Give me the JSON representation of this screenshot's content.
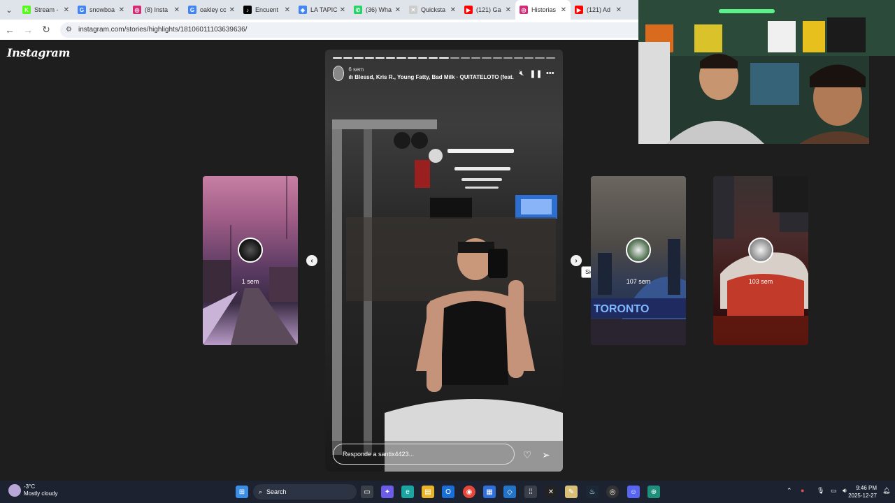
{
  "browser": {
    "tabs": [
      {
        "label": "Stream -",
        "favicon_color": "#53fc18",
        "glyph": "K"
      },
      {
        "label": "snowboa",
        "favicon_color": "#4285f4",
        "glyph": "G"
      },
      {
        "label": "(8) Insta",
        "favicon_color": "#d62976",
        "glyph": "◎"
      },
      {
        "label": "oakley cc",
        "favicon_color": "#4285f4",
        "glyph": "G"
      },
      {
        "label": "Encuent",
        "favicon_color": "#000000",
        "glyph": "♪"
      },
      {
        "label": "LA TAPIC",
        "favicon_color": "#4285f4",
        "glyph": "◈"
      },
      {
        "label": "(36) Wha",
        "favicon_color": "#25d366",
        "glyph": "✆"
      },
      {
        "label": "Quicksta",
        "favicon_color": "#cccccc",
        "glyph": "✕"
      },
      {
        "label": "(121) Ga",
        "favicon_color": "#ff0000",
        "glyph": "▶"
      },
      {
        "label": "Historias",
        "favicon_color": "#d62976",
        "glyph": "◎",
        "active": true
      },
      {
        "label": "(121) Ad",
        "favicon_color": "#ff0000",
        "glyph": "▶"
      }
    ],
    "url": "instagram.com/stories/highlights/18106011103639636/"
  },
  "instagram": {
    "logo": "Instagram",
    "story": {
      "time": "6 sem",
      "music": "Blessd, Kris R., Young Fatty, Bad Milk · QUITATELOTO (feat.",
      "reply_placeholder": "Responde a santix4423..."
    },
    "previews": [
      {
        "time": "1 sem",
        "side": "left"
      },
      {
        "time": "107 sem",
        "side": "right"
      },
      {
        "time": "103 sem",
        "side": "right"
      }
    ],
    "tooltip": "Siguiente"
  },
  "taskbar": {
    "weather_temp": "-3°C",
    "weather_desc": "Mostly cloudy",
    "search_label": "Search",
    "time": "9:46 PM",
    "date": "2025-12-27"
  }
}
